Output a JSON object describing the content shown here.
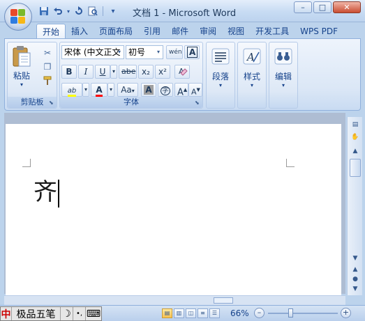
{
  "window": {
    "title": "文档 1 - Microsoft Word",
    "minimize": "–",
    "maximize": "□",
    "close": "✕"
  },
  "quick_access": {
    "save_icon": "save-icon",
    "undo_icon": "undo-icon",
    "redo_icon": "redo-icon",
    "print_preview_icon": "print-preview-icon",
    "customize": "▾"
  },
  "tabs": [
    {
      "label": "开始",
      "active": true
    },
    {
      "label": "插入"
    },
    {
      "label": "页面布局"
    },
    {
      "label": "引用"
    },
    {
      "label": "邮件"
    },
    {
      "label": "审阅"
    },
    {
      "label": "视图"
    },
    {
      "label": "开发工具"
    },
    {
      "label": "WPS PDF"
    }
  ],
  "ribbon": {
    "clipboard": {
      "label": "剪贴板",
      "paste": "粘贴",
      "paste_arrow": "▾"
    },
    "font": {
      "label": "字体",
      "font_name": "宋体 (中文正文",
      "font_size": "初号",
      "bold": "B",
      "italic": "I",
      "underline": "U",
      "strikethrough": "abe",
      "subscript": "x₂",
      "superscript": "x²",
      "clear_format": "A",
      "phonetic": "wén",
      "char_border": "A",
      "highlight": "ab",
      "font_color": "A",
      "change_case": "Aa",
      "char_shading": "A",
      "enclose": "字",
      "grow_font": "A",
      "shrink_font": "A",
      "highlight_color": "#ffff00",
      "font_color_value": "#ff0000"
    },
    "paragraph": {
      "label": "段落"
    },
    "styles": {
      "label": "样式"
    },
    "editing": {
      "label": "编辑"
    }
  },
  "document": {
    "text": "齐"
  },
  "status_bar": {
    "ime": {
      "mode": "中",
      "name": "极品五笔",
      "moon": "☽",
      "punct": "•,",
      "keyboard": "⌨"
    },
    "zoom_percent": "66%",
    "zoom_out": "–",
    "zoom_in": "+",
    "zoom_level": 0.66
  },
  "colors": {
    "accent": "#15428b",
    "ribbon_bg": "#dbe7f6",
    "close_button": "#c94c31"
  }
}
